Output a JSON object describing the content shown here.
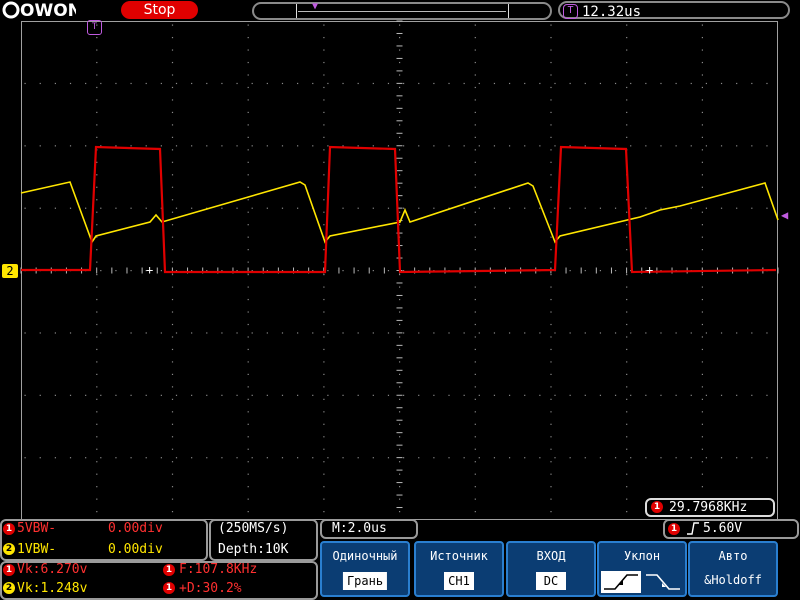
{
  "header": {
    "logo_text": "OWON",
    "status": "Stop",
    "trigger_position": "12.32us",
    "trigger_icon": "T"
  },
  "channels": {
    "ch1": {
      "num": "1",
      "color": "#e00000",
      "label": "5VBW-",
      "offset": "0.00div",
      "vk": "Vk:6.270v",
      "freq": "F:107.8KHz",
      "duty": "+D:30.2%"
    },
    "ch2": {
      "num": "2",
      "color": "#ffe600",
      "label": "1VBW-",
      "offset": "0.00div",
      "vk": "Vk:1.248v"
    }
  },
  "acquisition": {
    "rate": "(250MS/s)",
    "depth": "Depth:10K"
  },
  "timebase": "M:2.0us",
  "trigger": {
    "level": "5.60V",
    "freq_counter": "29.7968KHz"
  },
  "softkeys": [
    {
      "title": "Одиночный",
      "value": "Грань"
    },
    {
      "title": "Источник",
      "value": "CH1"
    },
    {
      "title": "ВХОД",
      "value": "DC"
    },
    {
      "title": "Уклон",
      "value": ""
    },
    {
      "title": "Авто",
      "value": "&Holdoff"
    }
  ],
  "colors": {
    "ch1": "#e00000",
    "ch2": "#ffe600",
    "trigger": "#c05be0",
    "softkey_bg": "#0b3d73"
  }
}
